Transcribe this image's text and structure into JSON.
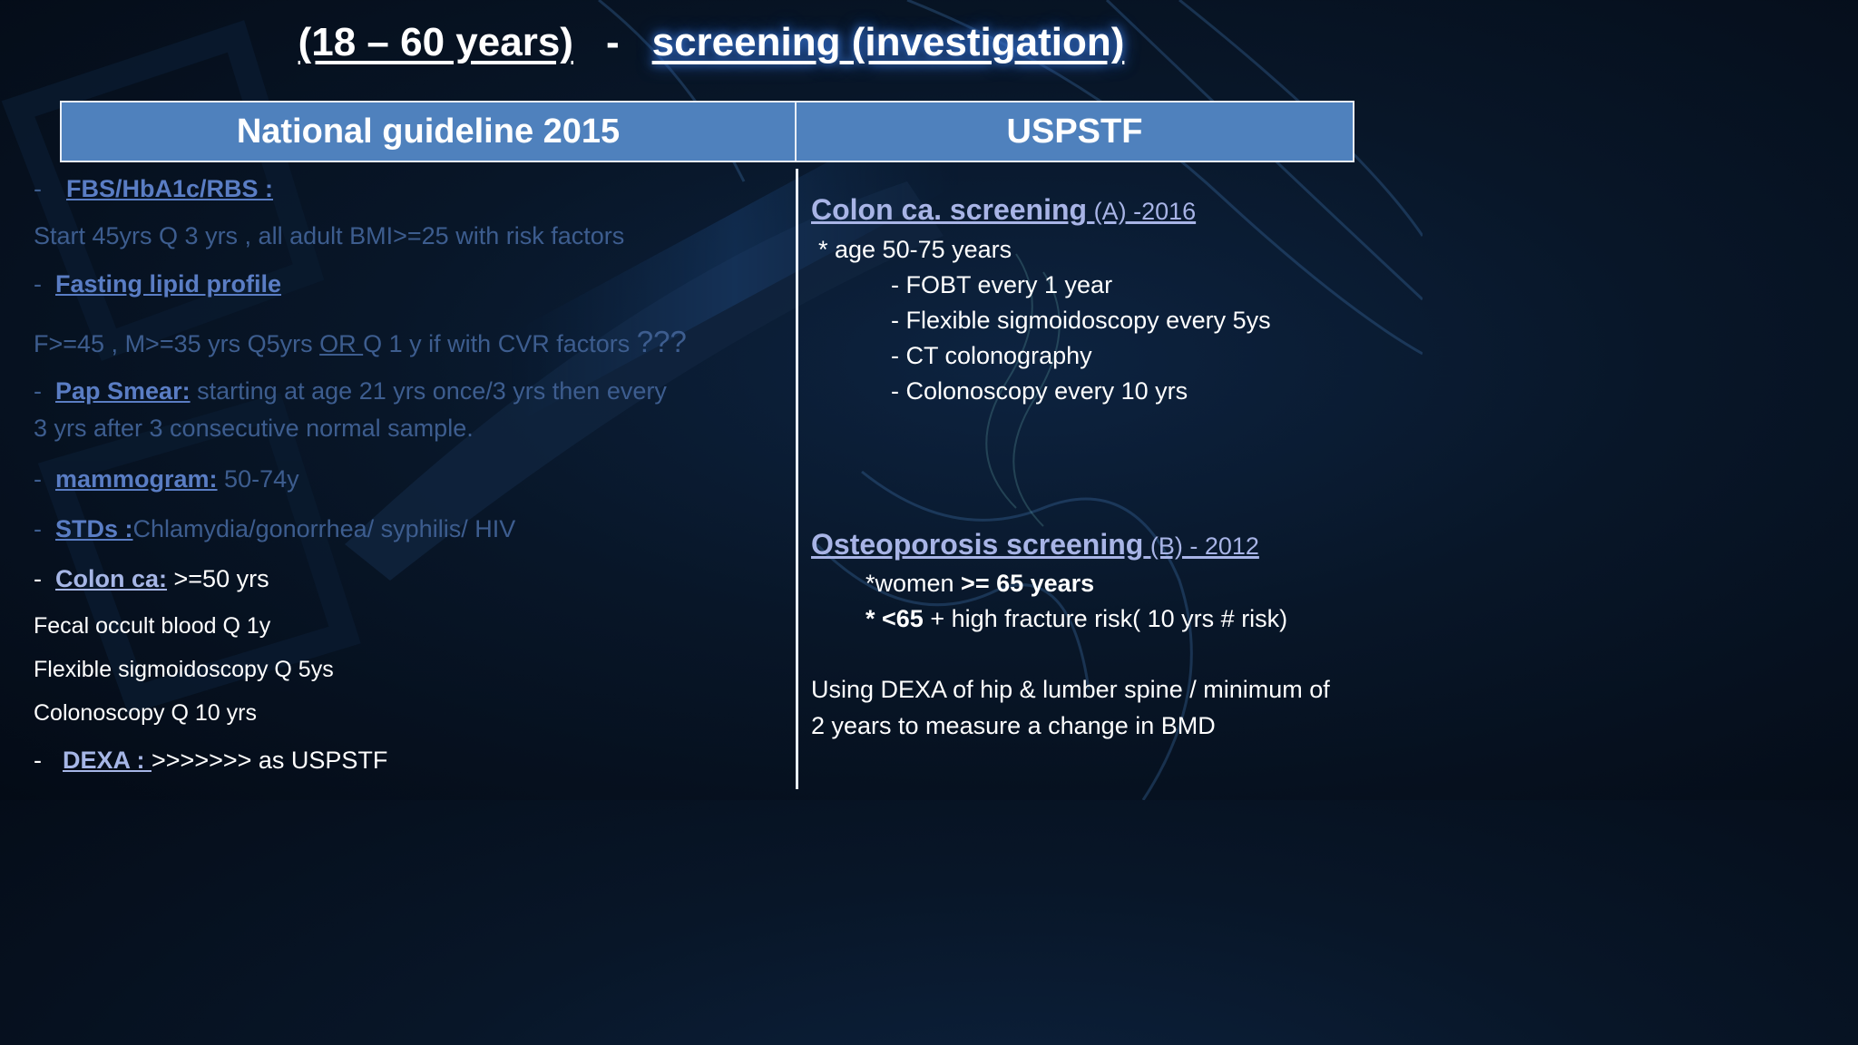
{
  "title": {
    "part1": "(18 – 60 years)",
    "separator": "-",
    "part2": "screening (investigation)"
  },
  "table": {
    "col_left": "National guideline 2015",
    "col_right": "USPSTF"
  },
  "left": {
    "fbs_dash": "-",
    "fbs_label": "FBS/HbA1c/RBS  :",
    "fbs_text": "Start 45yrs Q 3 yrs ,  all adult BMI>=25  with risk factors",
    "lipid_dash": "-",
    "lipid_label": "Fasting lipid profile",
    "lipid_text_a": "F>=45 , M>=35 yrs Q5yrs ",
    "lipid_text_or": "OR ",
    "lipid_text_b": "Q 1 y if with CVR factors ",
    "lipid_text_q": "???",
    "pap_dash": "-",
    "pap_label": "Pap Smear:",
    "pap_text1": "  starting at age 21 yrs once/3 yrs then every",
    "pap_text2": "3 yrs after 3 consecutive normal sample.",
    "mammo_dash": "-",
    "mammo_label": "mammogram:",
    "mammo_text": " 50-74y",
    "std_dash": "-",
    "std_label": "STDs :",
    "std_text": "Chlamydia/gonorrhea/ syphilis/ HIV",
    "colon_dash": "-",
    "colon_label": "Colon ca:",
    "colon_text": " >=50 yrs",
    "colon_line1": "Fecal occult blood Q 1y",
    "colon_line2": "Flexible sigmoidoscopy Q 5ys",
    "colon_line3": "Colonoscopy Q 10 yrs",
    "dexa_dash": "-",
    "dexa_label": "DEXA : ",
    "dexa_text": " >>>>>>> as USPSTF"
  },
  "right": {
    "colon_heading": "Colon ca. screening",
    "colon_grade": " (A) -2016",
    "colon_age": "* age 50-75 years",
    "colon_items": [
      "- FOBT  every 1 year",
      "- Flexible sigmoidoscopy every 5ys",
      "- CT colonography",
      "- Colonoscopy every 10 yrs"
    ],
    "osteo_heading": "Osteoporosis screening",
    "osteo_grade": " (B) - 2012",
    "osteo_women_a": "*women ",
    "osteo_women_b": ">= 65 years",
    "osteo_lt_a": "* <65",
    "osteo_lt_b": " + high fracture risk( 10 yrs # risk)",
    "dexa_line1": "Using DEXA of hip & lumber spine / minimum of",
    "dexa_line2": "2 years to measure a change in BMD"
  }
}
